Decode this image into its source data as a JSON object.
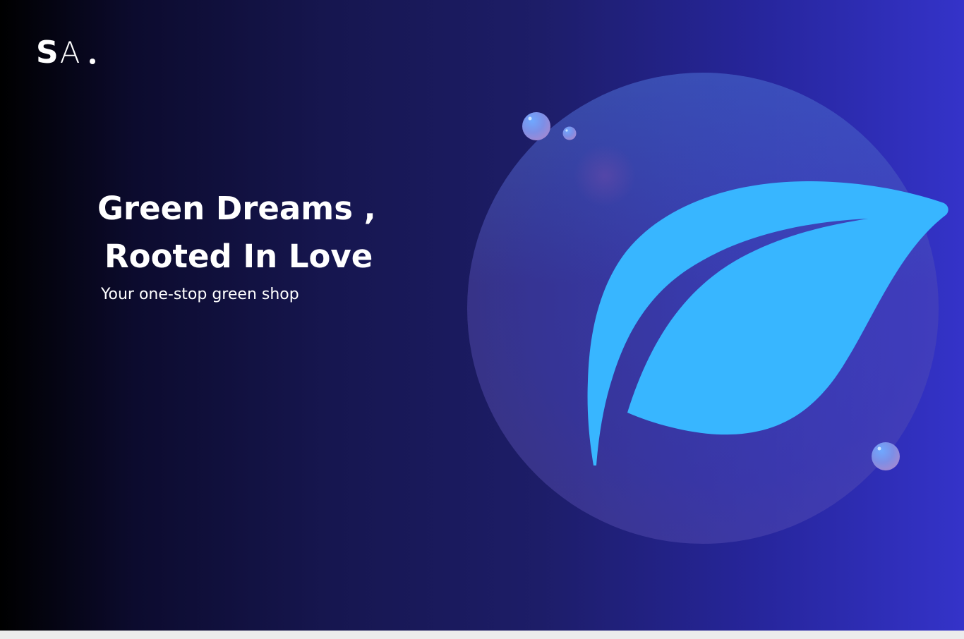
{
  "brand": {
    "logo_primary": "S",
    "logo_secondary": "A",
    "accent_colors": {
      "leaf": "#38b6ff",
      "gradient_start": "#000000",
      "gradient_end": "#3433c9"
    }
  },
  "hero": {
    "headline_line1": "Green Dreams ,",
    "headline_line2": "Rooted In Love",
    "tagline": "Your one-stop green shop"
  },
  "illustration": {
    "icon": "leaf-icon",
    "decorations": [
      "glass-sphere",
      "bubble-icon"
    ]
  }
}
